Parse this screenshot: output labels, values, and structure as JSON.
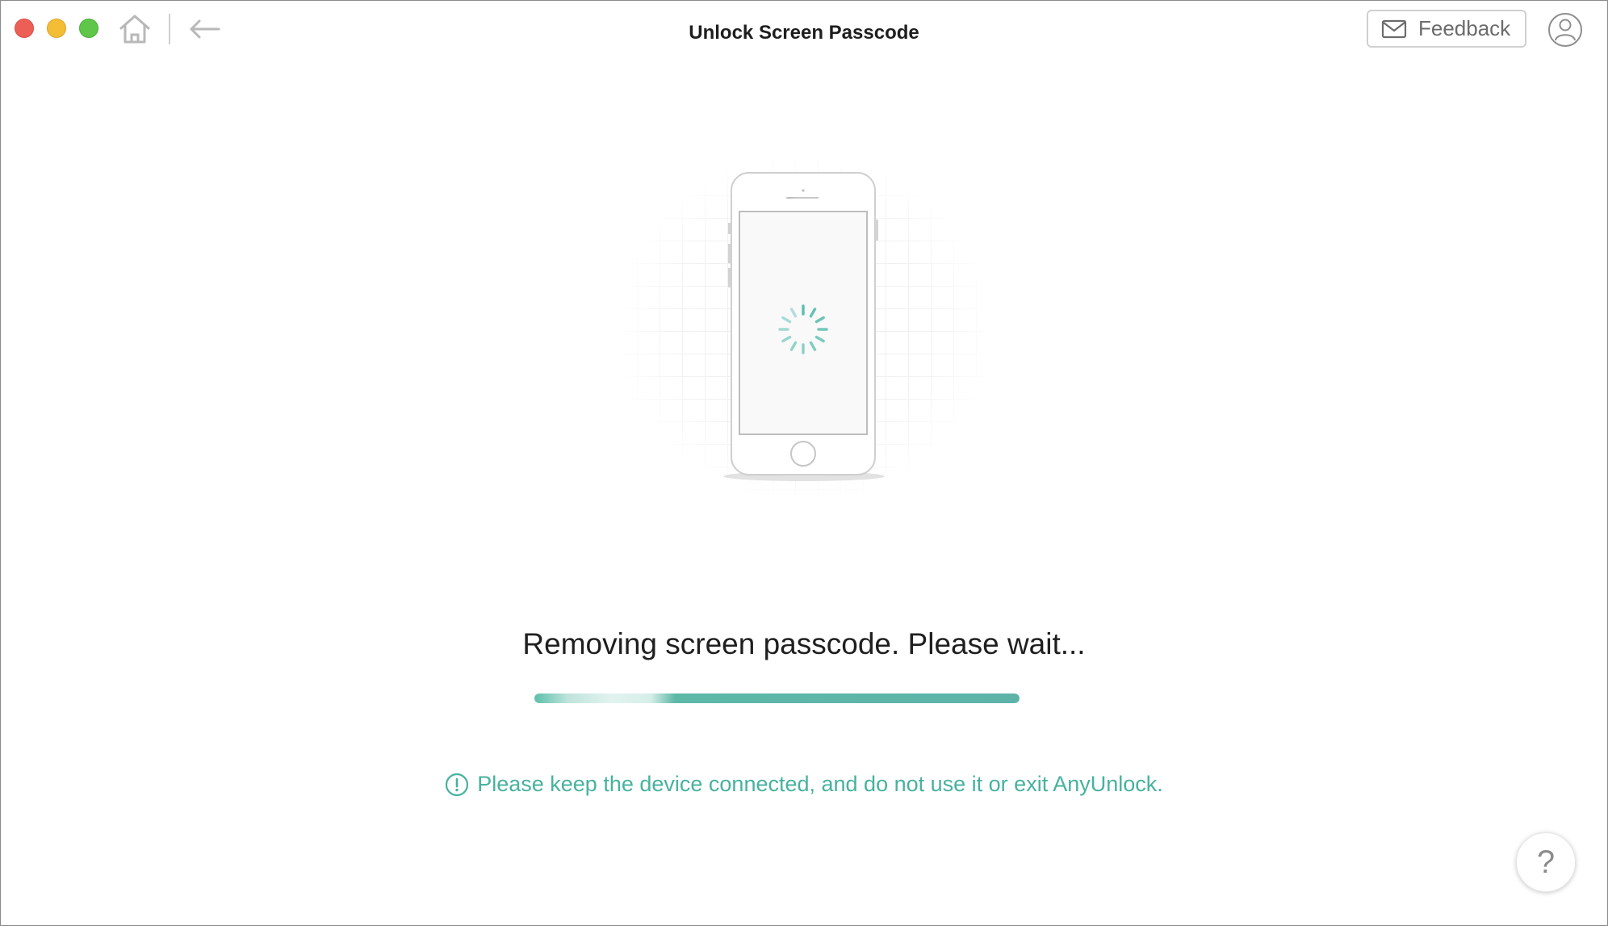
{
  "window": {
    "title": "Unlock Screen Passcode"
  },
  "titlebar": {
    "traffic_lights": [
      "close",
      "minimize",
      "zoom"
    ],
    "home_icon": "home-icon",
    "back_icon": "back-arrow-icon",
    "feedback_label": "Feedback",
    "feedback_icon": "mail-icon",
    "account_icon": "user-icon"
  },
  "main": {
    "illustration": "iphone-loading-illustration",
    "status": "Removing screen passcode. Please wait...",
    "progress_fraction": 1.0,
    "warning": "Please keep the device connected, and do not use it or exit AnyUnlock.",
    "warning_icon": "exclamation-circle-icon"
  },
  "help": {
    "label": "?"
  },
  "colors": {
    "accent": "#47b29e",
    "progress": "#5db3a8",
    "close": "#ec5f57",
    "minimize": "#f3bd36",
    "zoom": "#5fc64a"
  }
}
